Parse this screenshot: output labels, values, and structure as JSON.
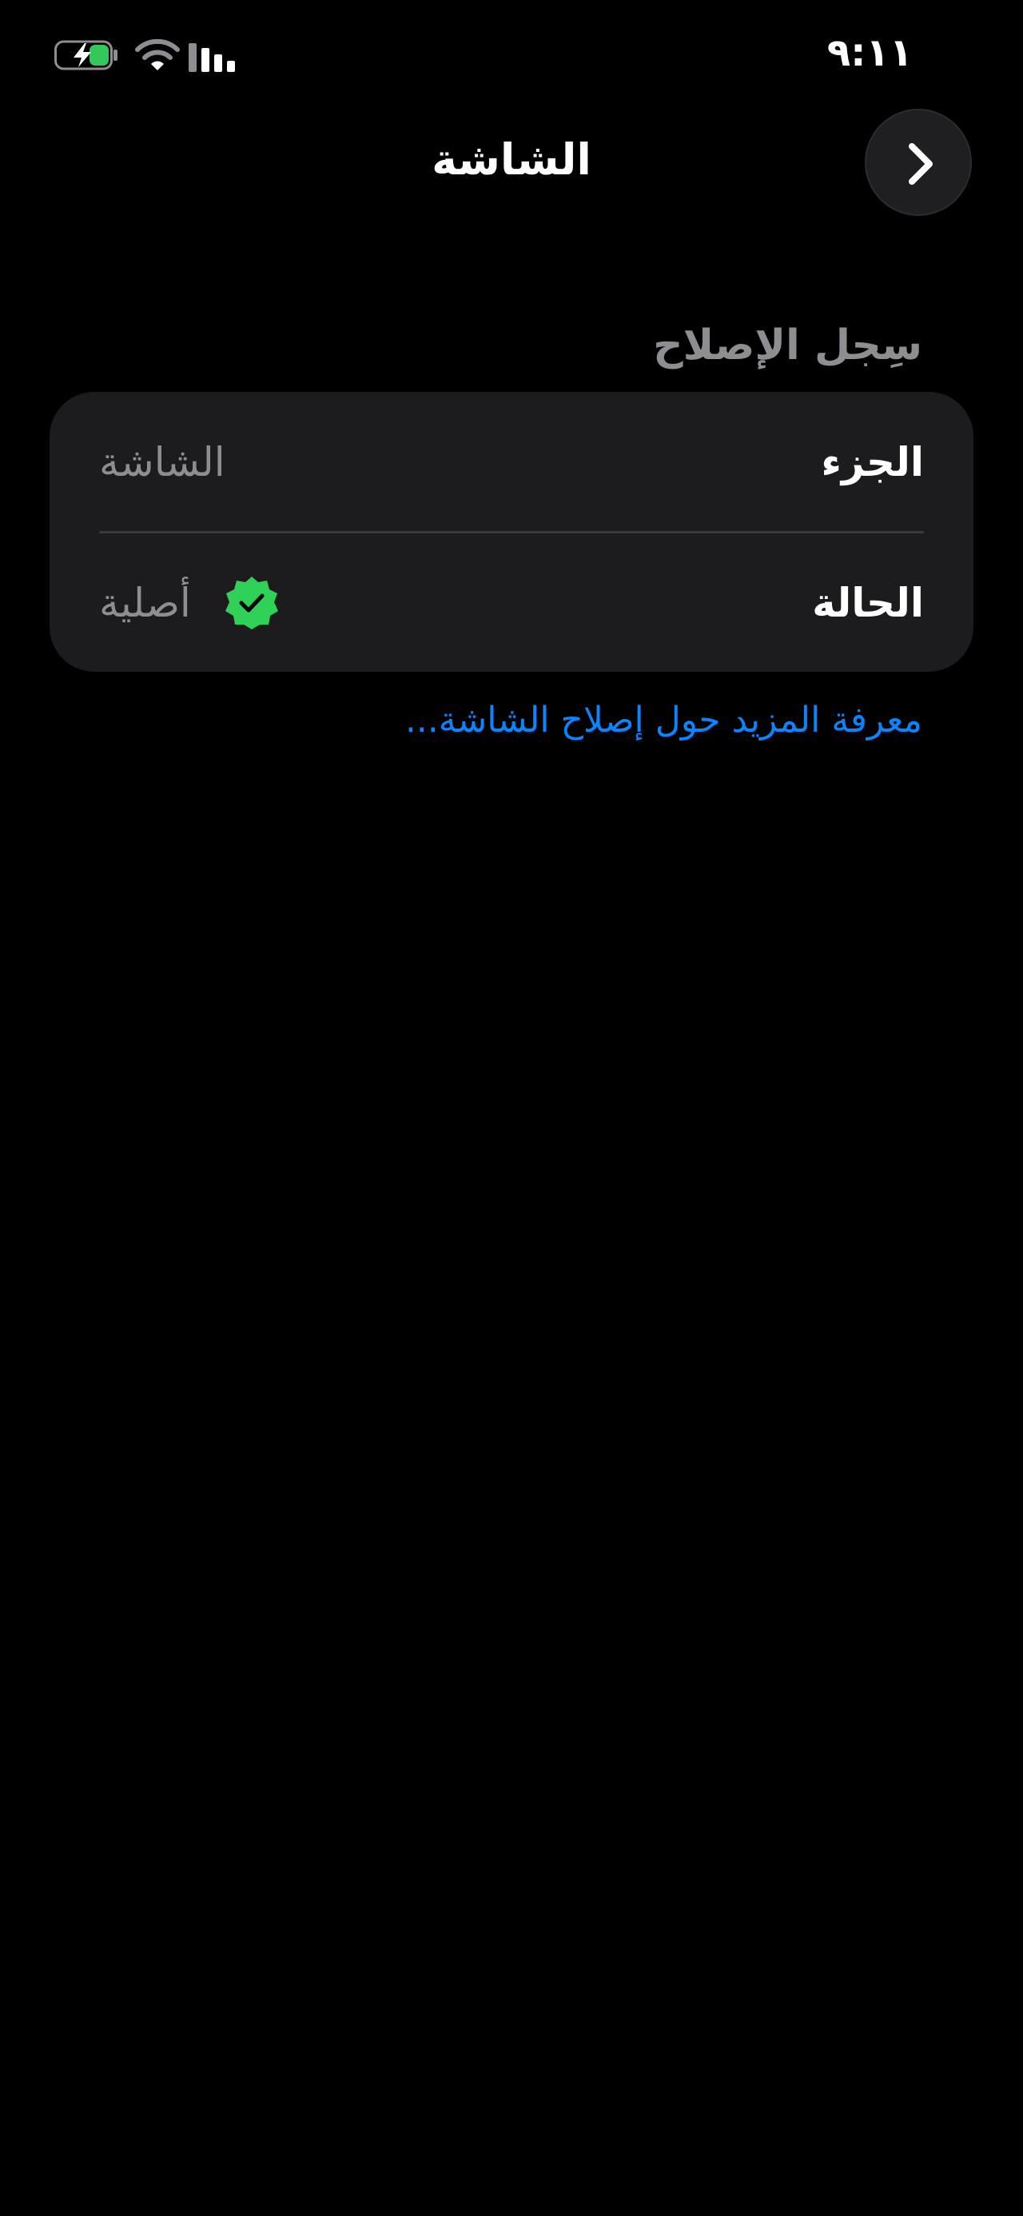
{
  "status_bar": {
    "time": "٩:١١",
    "battery_icon": "battery-charging-icon",
    "wifi_icon": "wifi-icon",
    "cellular_icon": "cellular-signal-icon",
    "battery_fill_color": "#34c759"
  },
  "nav": {
    "title": "الشاشة",
    "back_icon": "chevron-right-icon"
  },
  "repair_history": {
    "header": "سِجل الإصلاح",
    "rows": [
      {
        "label": "الجزء",
        "value": "الشاشة"
      },
      {
        "label": "الحالة",
        "value": "أصلية",
        "icon": "verified-badge-icon",
        "icon_color": "#30d158"
      }
    ],
    "link": "معرفة المزيد حول إصلاح الشاشة..."
  },
  "colors": {
    "background": "#000000",
    "card": "#1c1c1e",
    "secondary_text": "#8d8d92",
    "link": "#0a84ff"
  }
}
